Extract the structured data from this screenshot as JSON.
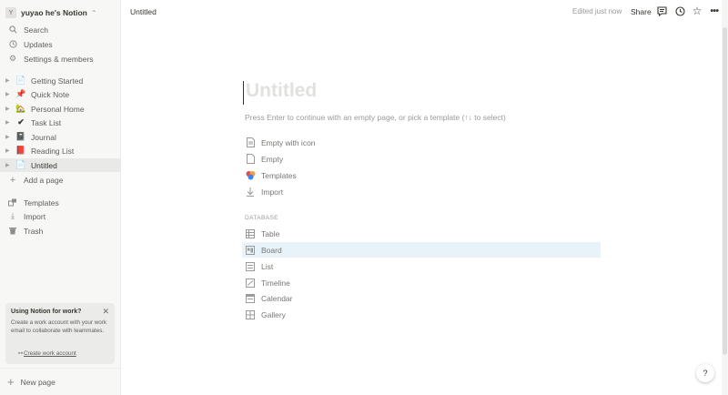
{
  "workspace": {
    "avatar_letter": "Y",
    "name": "yuyao he's Notion",
    "chevron": "⌃"
  },
  "sidebar": {
    "top_items": [
      {
        "label": "Search",
        "icon": "search-icon"
      },
      {
        "label": "Updates",
        "icon": "clock-icon"
      },
      {
        "label": "Settings & members",
        "icon": "gear-icon"
      }
    ],
    "pages": [
      {
        "label": "Getting Started",
        "emoji": "📄"
      },
      {
        "label": "Quick Note",
        "emoji": "📌"
      },
      {
        "label": "Personal Home",
        "emoji": "🏡"
      },
      {
        "label": "Task List",
        "emoji": "✔"
      },
      {
        "label": "Journal",
        "emoji": "📓"
      },
      {
        "label": "Reading List",
        "emoji": "📕"
      },
      {
        "label": "Untitled",
        "emoji": "📄"
      }
    ],
    "add_page": "Add a page",
    "bottom_items": [
      {
        "label": "Templates",
        "icon": "templates-icon"
      },
      {
        "label": "Import",
        "icon": "import-icon"
      },
      {
        "label": "Trash",
        "icon": "trash-icon"
      }
    ],
    "promo": {
      "title": "Using Notion for work?",
      "text": "Create a work account with your work email to collaborate with teammates.",
      "link": "Create work account"
    },
    "new_page": "New page"
  },
  "topbar": {
    "title": "Untitled",
    "edited": "Edited just now",
    "share": "Share"
  },
  "main": {
    "title_placeholder": "Untitled",
    "hint": "Press Enter to continue with an empty page, or pick a template (↑↓ to select)",
    "options": [
      {
        "label": "Empty with icon",
        "icon": "page-icon"
      },
      {
        "label": "Empty",
        "icon": "page-icon"
      },
      {
        "label": "Templates",
        "icon": "templates-color-icon"
      },
      {
        "label": "Import",
        "icon": "import-icon"
      }
    ],
    "database_header": "DATABASE",
    "database_options": [
      {
        "label": "Table",
        "icon": "table-icon"
      },
      {
        "label": "Board",
        "icon": "board-icon"
      },
      {
        "label": "List",
        "icon": "list-icon"
      },
      {
        "label": "Timeline",
        "icon": "timeline-icon"
      },
      {
        "label": "Calendar",
        "icon": "calendar-icon"
      },
      {
        "label": "Gallery",
        "icon": "gallery-icon"
      }
    ]
  },
  "help": "?"
}
